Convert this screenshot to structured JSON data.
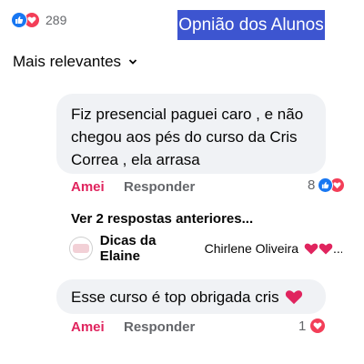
{
  "reactions": {
    "count": "289"
  },
  "banner": {
    "title": "Opnião dos Alunos"
  },
  "sort": {
    "label": "Mais relevantes"
  },
  "comment1": {
    "line1": "Fiz presencial paguei caro , e não",
    "line2": "chegou aos pés do curso da Cris",
    "line3": "Correa , ela arrasa",
    "love_label": "Amei",
    "reply_label": "Responder",
    "reaction_count": "8"
  },
  "previous_replies": {
    "label": "Ver 2 respostas anteriores..."
  },
  "reply_preview": {
    "author": "Dicas da Elaine",
    "text": "Chirlene Oliveira"
  },
  "comment2": {
    "text": "Esse curso é top obrigada cris",
    "love_label": "Amei",
    "reply_label": "Responder",
    "reaction_count": "1"
  },
  "colors": {
    "like_blue": "#1877f2",
    "love_red": "#f33e58",
    "banner_blue": "#3d55d0",
    "bubble_gray": "#f0f2f5",
    "love_text": "#e0245e"
  },
  "icons": [
    "like-icon",
    "love-icon",
    "chevron-down-icon",
    "heart-emoji-icon",
    "avatar-icon"
  ]
}
